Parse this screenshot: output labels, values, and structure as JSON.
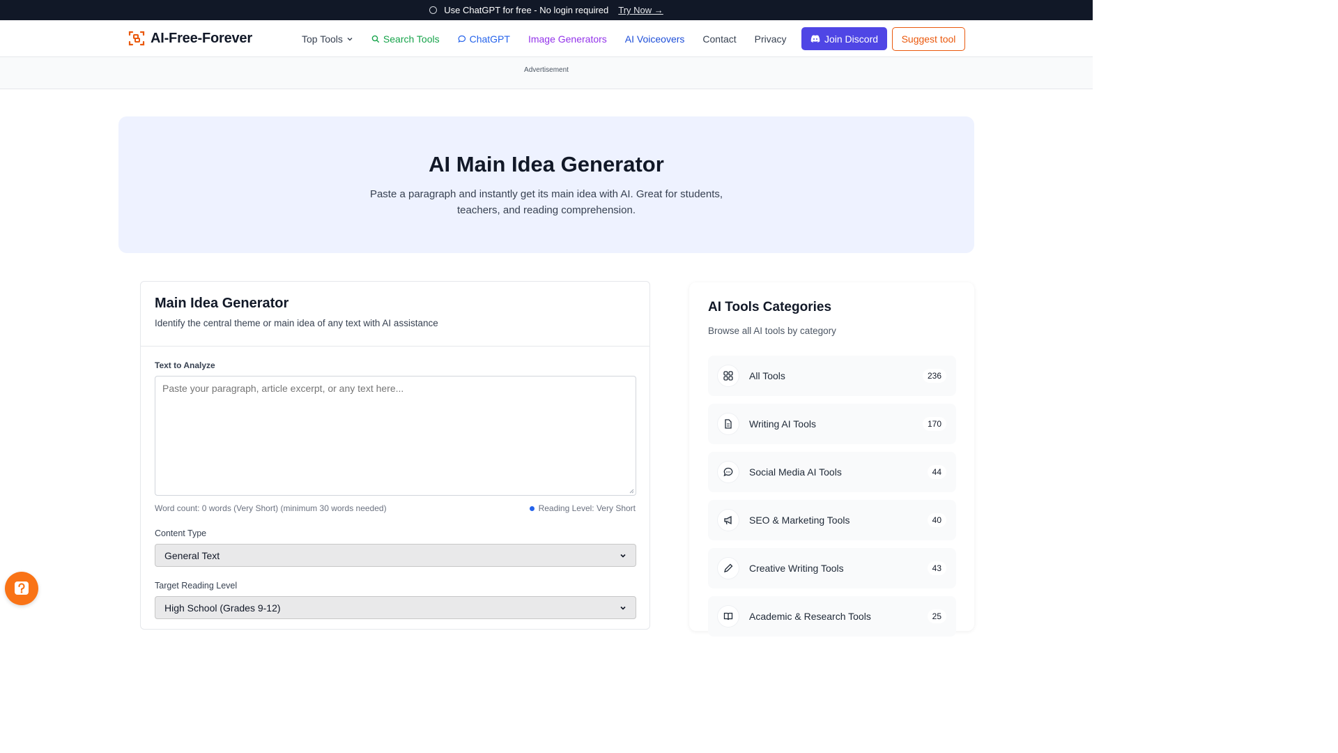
{
  "banner": {
    "text": "Use ChatGPT for free - No login required",
    "link": "Try Now →"
  },
  "nav": {
    "logo": "AI-Free-Forever",
    "links": [
      {
        "label": "Top Tools",
        "icon": "chevron-down-icon"
      },
      {
        "label": "Search Tools",
        "icon": "search-icon"
      },
      {
        "label": "ChatGPT",
        "icon": "chat-bubble-icon"
      },
      {
        "label": "Image Generators"
      },
      {
        "label": "AI Voiceovers"
      },
      {
        "label": "Contact"
      },
      {
        "label": "Privacy"
      }
    ],
    "discord_button": "Join Discord",
    "suggest_button": "Suggest tool"
  },
  "ad": {
    "label": "Advertisement"
  },
  "hero": {
    "title": "AI Main Idea Generator",
    "subtitle": "Paste a paragraph and instantly get its main idea with AI. Great for students, teachers, and reading comprehension."
  },
  "generator": {
    "title": "Main Idea Generator",
    "subtitle": "Identify the central theme or main idea of any text with AI assistance",
    "text_label": "Text to Analyze",
    "text_placeholder": "Paste your paragraph, article excerpt, or any text here...",
    "word_count": "Word count: 0 words (Very Short) (minimum 30 words needed)",
    "reading_level": "Reading Level: Very Short",
    "content_type_label": "Content Type",
    "content_type_value": "General Text",
    "target_level_label": "Target Reading Level",
    "target_level_value": "High School (Grades 9-12)"
  },
  "sidebar": {
    "title": "AI Tools Categories",
    "subtitle": "Browse all AI tools by category",
    "categories": [
      {
        "name": "All Tools",
        "count": "236",
        "icon": "grid-icon"
      },
      {
        "name": "Writing AI Tools",
        "count": "170",
        "icon": "document-icon"
      },
      {
        "name": "Social Media AI Tools",
        "count": "44",
        "icon": "chat-bubble-icon"
      },
      {
        "name": "SEO & Marketing Tools",
        "count": "40",
        "icon": "megaphone-icon"
      },
      {
        "name": "Creative Writing Tools",
        "count": "43",
        "icon": "pencil-icon"
      },
      {
        "name": "Academic & Research Tools",
        "count": "25",
        "icon": "book-icon"
      }
    ]
  },
  "help": {
    "icon": "help-icon"
  },
  "colors": {
    "accent": "#4f46e5",
    "brand_orange": "#ea580c",
    "hero_bg": "#eef2ff",
    "banner_bg": "#111827"
  }
}
